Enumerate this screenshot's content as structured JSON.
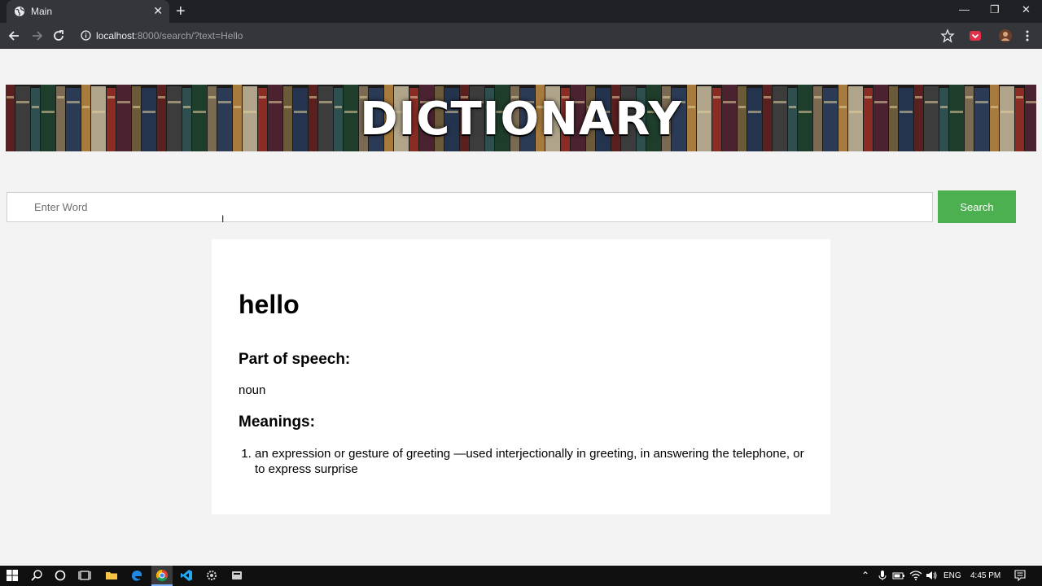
{
  "browser": {
    "tab_title": "Main",
    "tab_close": "✕",
    "new_tab": "+",
    "url_host": "localhost",
    "url_rest": ":8000/search/?text=Hello",
    "window_controls": {
      "minimize": "—",
      "maximize": "❐",
      "close": "✕"
    }
  },
  "banner": {
    "title": "DICTIONARY"
  },
  "search": {
    "placeholder": "Enter Word",
    "button_label": "Search"
  },
  "result": {
    "word": "hello",
    "part_of_speech_heading": "Part of speech:",
    "part_of_speech": "noun",
    "meanings_heading": "Meanings:",
    "meanings": [
      "an expression or gesture of greeting —used interjectionally in greeting, in answering the telephone, or to express surprise"
    ]
  },
  "taskbar": {
    "language": "ENG",
    "time": "4:45 PM"
  },
  "colors": {
    "search_button": "#4caf50",
    "chrome_dark": "#202124",
    "chrome_toolbar": "#35363a",
    "taskbar": "#101010"
  }
}
